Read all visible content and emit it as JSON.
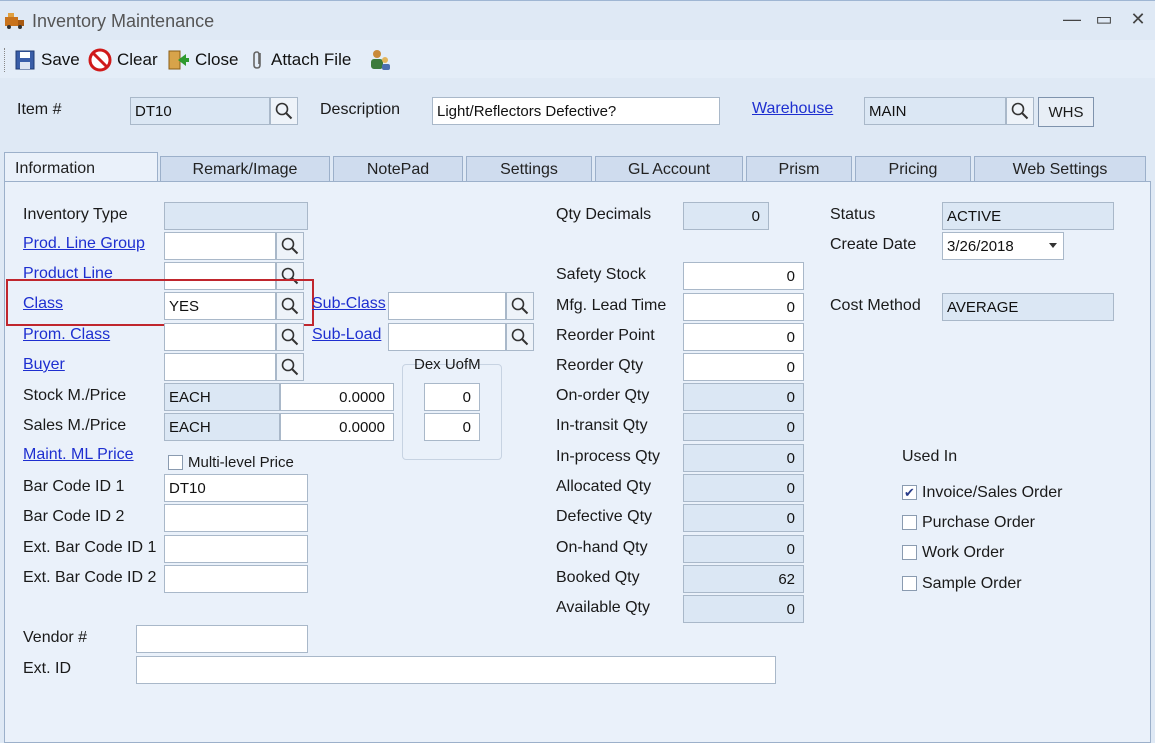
{
  "window": {
    "title": "Inventory Maintenance",
    "minimize": "—",
    "maximize": "▭",
    "close": "✕"
  },
  "toolbar": {
    "save_label": "Save",
    "clear_label": "Clear",
    "close_label": "Close",
    "attach_label": "Attach File"
  },
  "header": {
    "item_label": "Item #",
    "item_value": "DT10",
    "description_label": "Description",
    "description_value": "Light/Reflectors Defective?",
    "warehouse_label": "Warehouse",
    "warehouse_value": "MAIN",
    "whs_button": "WHS"
  },
  "tabs": [
    "Information",
    "Remark/Image",
    "NotePad",
    "Settings",
    "GL Account",
    "Prism",
    "Pricing",
    "Web Settings"
  ],
  "info": {
    "inventory_type_label": "Inventory Type",
    "inventory_type_value": "",
    "prod_line_group_label": "Prod. Line Group",
    "prod_line_group_value": "",
    "product_line_label": "Product Line",
    "product_line_value": "",
    "class_label": "Class",
    "class_value": "YES",
    "sub_class_label": "Sub-Class",
    "sub_class_value": "",
    "prom_class_label": "Prom. Class",
    "prom_class_value": "",
    "sub_load_label": "Sub-Load",
    "sub_load_value": "",
    "buyer_label": "Buyer",
    "buyer_value": "",
    "dex_uofm_label": "Dex UofM",
    "stock_label": "Stock M./Price",
    "stock_unit": "EACH",
    "stock_price": "0.0000",
    "stock_dex": "0",
    "sales_label": "Sales M./Price",
    "sales_unit": "EACH",
    "sales_price": "0.0000",
    "sales_dex": "0",
    "maint_ml_label": "Maint. ML Price",
    "multi_level_label": "Multi-level Price",
    "multi_level_checked": false,
    "bar1_label": "Bar Code ID 1",
    "bar1_value": "DT10",
    "bar2_label": "Bar Code ID 2",
    "bar2_value": "",
    "ext_bar1_label": "Ext. Bar Code ID 1",
    "ext_bar1_value": "",
    "ext_bar2_label": "Ext. Bar Code ID 2",
    "ext_bar2_value": "",
    "vendor_label": "Vendor #",
    "vendor_value": "",
    "ext_id_label": "Ext. ID",
    "ext_id_value": ""
  },
  "quantities": {
    "qty_decimals_label": "Qty Decimals",
    "qty_decimals_value": "0",
    "safety_stock_label": "Safety Stock",
    "safety_stock_value": "0",
    "mfg_lead_label": "Mfg. Lead Time",
    "mfg_lead_value": "0",
    "reorder_point_label": "Reorder Point",
    "reorder_point_value": "0",
    "reorder_qty_label": "Reorder Qty",
    "reorder_qty_value": "0",
    "on_order_label": "On-order Qty",
    "on_order_value": "0",
    "in_transit_label": "In-transit Qty",
    "in_transit_value": "0",
    "in_process_label": "In-process Qty",
    "in_process_value": "0",
    "allocated_label": "Allocated Qty",
    "allocated_value": "0",
    "defective_label": "Defective Qty",
    "defective_value": "0",
    "on_hand_label": "On-hand Qty",
    "on_hand_value": "0",
    "booked_label": "Booked Qty",
    "booked_value": "62",
    "available_label": "Available Qty",
    "available_value": "0"
  },
  "status": {
    "status_label": "Status",
    "status_value": "ACTIVE",
    "create_date_label": "Create Date",
    "create_date_value": "3/26/2018",
    "cost_method_label": "Cost Method",
    "cost_method_value": "AVERAGE",
    "used_in_label": "Used In",
    "used_in": [
      {
        "label": "Invoice/Sales Order",
        "checked": true
      },
      {
        "label": "Purchase Order",
        "checked": false
      },
      {
        "label": "Work Order",
        "checked": false
      },
      {
        "label": "Sample Order",
        "checked": false
      }
    ]
  },
  "colors": {
    "accent_link": "#1e2fd0",
    "highlight_border": "#c0262d"
  }
}
